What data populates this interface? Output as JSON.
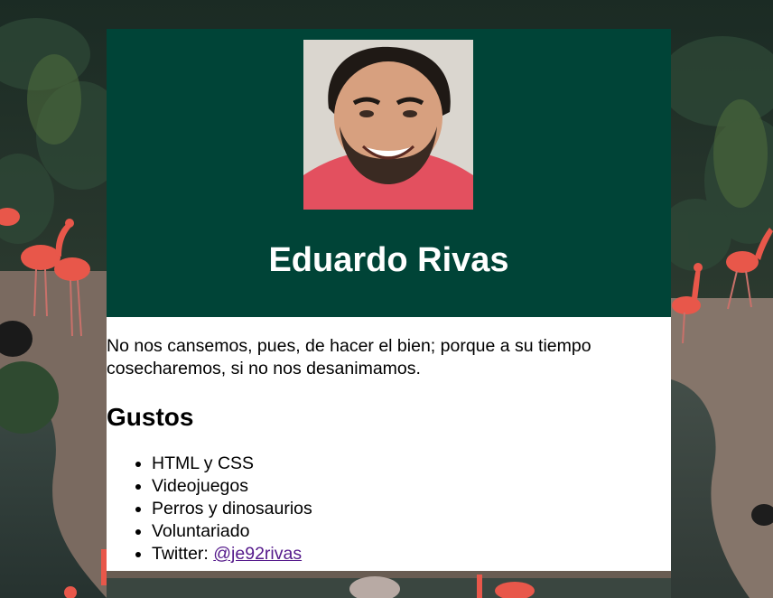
{
  "profile": {
    "name": "Eduardo Rivas",
    "photo_icon": "profile-photo",
    "quote": "No nos cansemos, pues, de hacer el bien; porque a su tiempo cosecharemos, si no nos desanimamos."
  },
  "likes": {
    "title": "Gustos",
    "items": [
      {
        "label": "HTML y CSS"
      },
      {
        "label": "Videojuegos"
      },
      {
        "label": "Perros y dinosaurios"
      },
      {
        "label": "Voluntariado"
      },
      {
        "label": "Twitter: ",
        "link_text": "@je92rivas"
      }
    ]
  },
  "colors": {
    "header_bg": "#004437",
    "card_bg": "#ffffff",
    "link": "#551a8b",
    "background_theme": "flamingo-lagoon-photo"
  }
}
